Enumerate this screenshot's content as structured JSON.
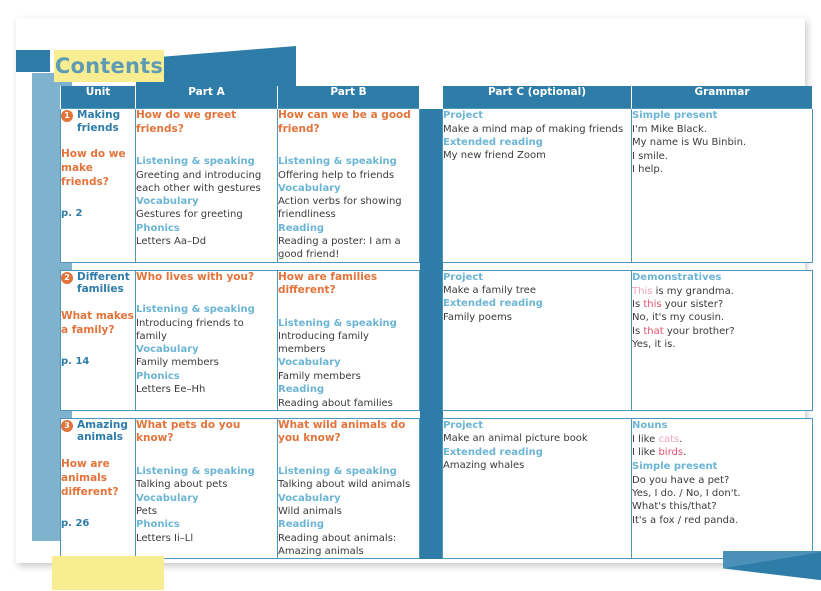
{
  "page": {
    "title": "Contents"
  },
  "table": {
    "headers": [
      "Unit",
      "Part A",
      "Part B",
      "Part C (optional)",
      "Grammar"
    ],
    "rows": [
      {
        "unit": {
          "number": "1",
          "name": "Making friends",
          "question": "How do we make friends?",
          "page": "p. 2"
        },
        "part_a": {
          "question": "How do we greet friends?",
          "sections": [
            {
              "label": "Listening & speaking",
              "text": "Greeting and introducing each other with gestures"
            },
            {
              "label": "Vocabulary",
              "text": "Gestures for greeting"
            },
            {
              "label": "Phonics",
              "text": "Letters Aa–Dd"
            }
          ]
        },
        "part_b": {
          "question": "How can we be a good friend?",
          "sections": [
            {
              "label": "Listening & speaking",
              "text": "Offering help to friends"
            },
            {
              "label": "Vocabulary",
              "text": "Action verbs for showing friendliness"
            },
            {
              "label": "Reading",
              "text": "Reading a poster: I am a good friend!"
            }
          ]
        },
        "part_c": {
          "sections": [
            {
              "label": "Project",
              "text": "Make a mind map of making friends"
            },
            {
              "label": "Extended reading",
              "text": "My new friend Zoom"
            }
          ]
        },
        "grammar": [
          {
            "label": "Simple present",
            "lines": [
              [
                {
                  "t": "I'm Mike Black.",
                  "c": "plain"
                }
              ],
              [
                {
                  "t": "My name is Wu Binbin.",
                  "c": "plain"
                }
              ],
              [
                {
                  "t": "I smile.",
                  "c": "plain"
                }
              ],
              [
                {
                  "t": "I help.",
                  "c": "plain"
                }
              ]
            ]
          }
        ]
      },
      {
        "unit": {
          "number": "2",
          "name": "Different families",
          "question": "What makes a family?",
          "page": "p. 14"
        },
        "part_a": {
          "question": "Who lives with you?",
          "sections": [
            {
              "label": "Listening & speaking",
              "text": "Introducing friends to family"
            },
            {
              "label": "Vocabulary",
              "text": "Family members"
            },
            {
              "label": "Phonics",
              "text": "Letters Ee–Hh"
            }
          ]
        },
        "part_b": {
          "question": "How are families different?",
          "sections": [
            {
              "label": "Listening & speaking",
              "text": "Introducing family members"
            },
            {
              "label": "Vocabulary",
              "text": "Family members"
            },
            {
              "label": "Reading",
              "text": "Reading about families"
            }
          ]
        },
        "part_c": {
          "sections": [
            {
              "label": "Project",
              "text": "Make a family tree"
            },
            {
              "label": "Extended reading",
              "text": "Family poems"
            }
          ]
        },
        "grammar": [
          {
            "label": "Demonstratives",
            "lines": [
              [
                {
                  "t": "This",
                  "c": "pink"
                },
                {
                  "t": " is my grandma.",
                  "c": "plain"
                }
              ],
              [
                {
                  "t": "Is ",
                  "c": "plain"
                },
                {
                  "t": "this",
                  "c": "red"
                },
                {
                  "t": " your sister?",
                  "c": "plain"
                }
              ],
              [
                {
                  "t": "No, it's my cousin.",
                  "c": "plain"
                }
              ],
              [
                {
                  "t": "Is ",
                  "c": "plain"
                },
                {
                  "t": "that",
                  "c": "red"
                },
                {
                  "t": " your brother?",
                  "c": "plain"
                }
              ],
              [
                {
                  "t": "Yes, it is.",
                  "c": "plain"
                }
              ]
            ]
          }
        ]
      },
      {
        "unit": {
          "number": "3",
          "name": "Amazing animals",
          "question": "How are animals different?",
          "page": "p. 26"
        },
        "part_a": {
          "question": "What pets do you know?",
          "sections": [
            {
              "label": "Listening & speaking",
              "text": "Talking about pets"
            },
            {
              "label": "Vocabulary",
              "text": "Pets"
            },
            {
              "label": "Phonics",
              "text": "Letters Ii–Ll"
            }
          ]
        },
        "part_b": {
          "question": "What wild animals do you know?",
          "sections": [
            {
              "label": "Listening & speaking",
              "text": "Talking about wild animals"
            },
            {
              "label": "Vocabulary",
              "text": "Wild animals"
            },
            {
              "label": "Reading",
              "text": "Reading about animals: Amazing animals"
            }
          ]
        },
        "part_c": {
          "sections": [
            {
              "label": "Project",
              "text": "Make an animal picture book"
            },
            {
              "label": "Extended reading",
              "text": "Amazing whales"
            }
          ]
        },
        "grammar": [
          {
            "label": "Nouns",
            "lines": [
              [
                {
                  "t": "I like ",
                  "c": "plain"
                },
                {
                  "t": "cats",
                  "c": "pink"
                },
                {
                  "t": ".",
                  "c": "plain"
                }
              ],
              [
                {
                  "t": "I like ",
                  "c": "plain"
                },
                {
                  "t": "birds",
                  "c": "red"
                },
                {
                  "t": ".",
                  "c": "plain"
                }
              ]
            ]
          },
          {
            "label": "Simple present",
            "lines": [
              [
                {
                  "t": "Do you have a pet?",
                  "c": "plain"
                }
              ],
              [
                {
                  "t": "Yes, I do. / No, I don't.",
                  "c": "plain"
                }
              ],
              [
                {
                  "t": "What's this/that?",
                  "c": "plain"
                }
              ],
              [
                {
                  "t": "It's a fox / red panda.",
                  "c": "plain"
                }
              ]
            ]
          }
        ]
      }
    ]
  },
  "colors": {
    "header_blue": "#2e7ca8",
    "light_blue": "#6cb5d4",
    "orange": "#e2733a",
    "yellow": "#f9ed92",
    "pink": "#f0a5bb",
    "red": "#e8536e",
    "panel_blue": "#7fb3cd"
  }
}
